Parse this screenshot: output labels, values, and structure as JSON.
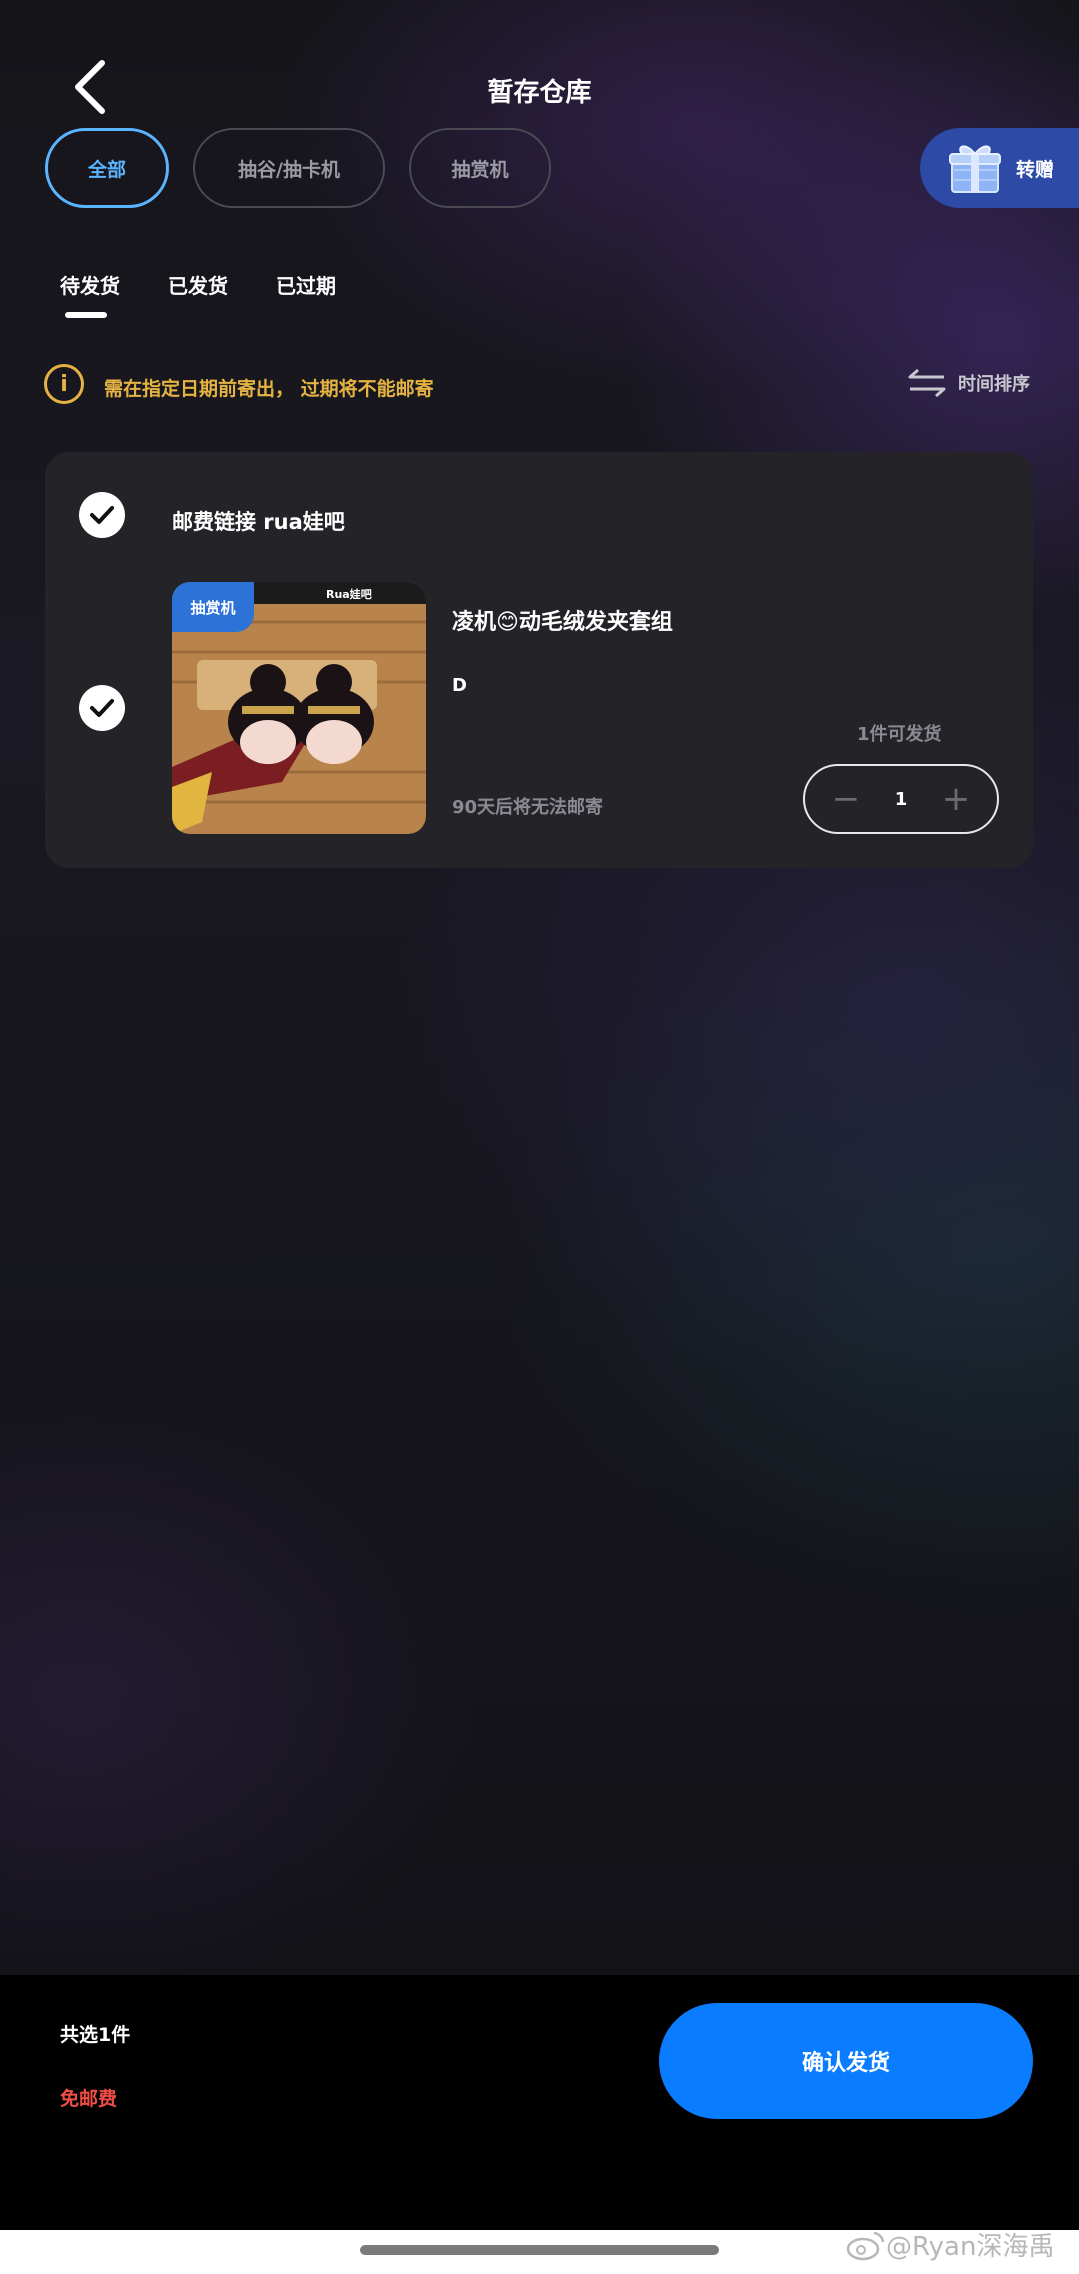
{
  "header": {
    "title": "暂存仓库"
  },
  "filters": [
    {
      "label": "全部",
      "active": true
    },
    {
      "label": "抽谷/抽卡机",
      "active": false
    },
    {
      "label": "抽赏机",
      "active": false
    }
  ],
  "gift": {
    "label": "转赠",
    "icon": "gift-box-icon"
  },
  "tabs": [
    {
      "label": "待发货",
      "active": true
    },
    {
      "label": "已发货",
      "active": false
    },
    {
      "label": "已过期",
      "active": false
    }
  ],
  "notice": {
    "icon": "info-icon",
    "icon_glyph": "i",
    "text": "需在指定日期前寄出， 过期将不能邮寄"
  },
  "sort": {
    "label": "时间排序",
    "icon": "swap-arrows-icon"
  },
  "card": {
    "store_name": "邮费链接 rua娃吧",
    "item": {
      "badge": "抽赏机",
      "title": "凌机😊动毛绒发夹套组",
      "variant": "D",
      "expire": "90天后将无法邮寄",
      "ship_count": "1件可发货",
      "quantity": "1",
      "thumb_overlay_text": "Rua娃吧"
    }
  },
  "stepper": {
    "minus": "−",
    "plus": "+"
  },
  "footer": {
    "selected": "共选1件",
    "postage": "免邮费",
    "confirm": "确认发货"
  },
  "watermark": "@Ryan深海禹",
  "colors": {
    "accent_blue": "#0a7cff",
    "active_pill": "#5ab4ff",
    "notice_yellow": "#e5b342",
    "postage_red": "#f04d45",
    "gift_bg": "#2d4aa6"
  }
}
